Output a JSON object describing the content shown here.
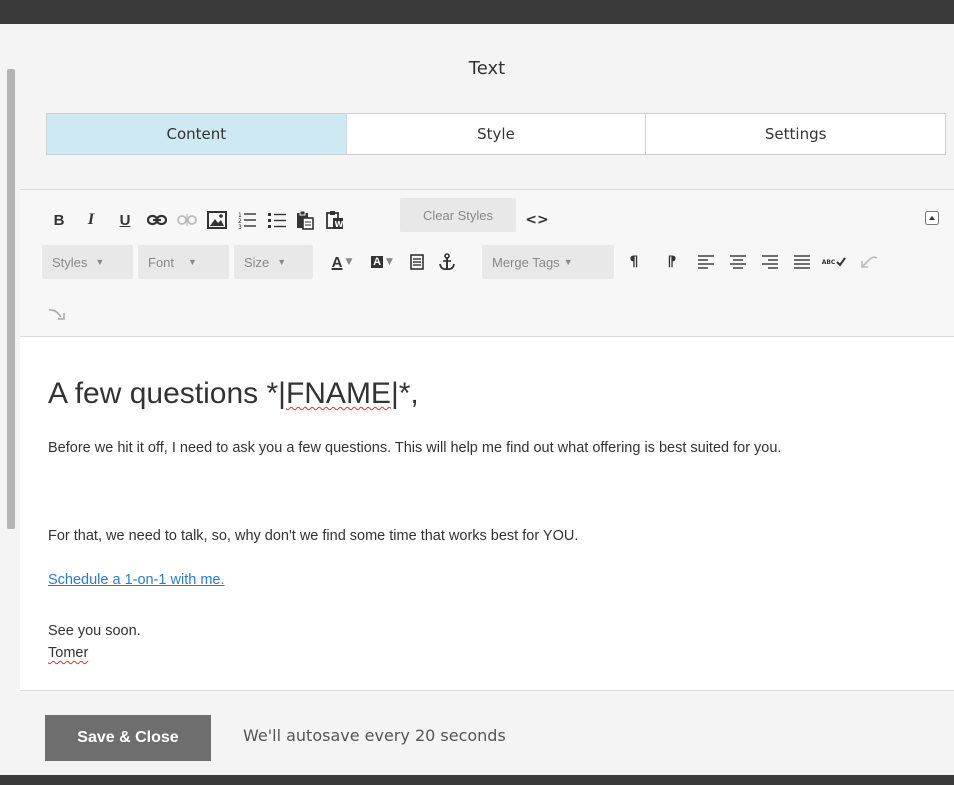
{
  "dialog": {
    "title": "Text"
  },
  "tabs": [
    {
      "label": "Content",
      "active": true
    },
    {
      "label": "Style",
      "active": false
    },
    {
      "label": "Settings",
      "active": false
    }
  ],
  "toolbar": {
    "bold": "B",
    "italic": "I",
    "underline": "U",
    "clear_styles": "Clear Styles",
    "source": "<>",
    "styles": "Styles",
    "font": "Font",
    "size": "Size",
    "text_color": "A",
    "bg_color": "A",
    "merge_tags": "Merge Tags",
    "pilcrow": "¶",
    "rtl": "⁋",
    "spell": "ABC"
  },
  "content": {
    "heading_prefix": "A few questions *|",
    "heading_tag": "FNAME",
    "heading_suffix": "|*,",
    "para1": "Before we hit it off, I need to ask you a few questions. This will help me find out what offering is best suited for you.",
    "para2": "For that, we need to talk, so, why don't we find some time that works best for YOU.",
    "link": "Schedule a 1-on-1 with me.",
    "signoff": "See you soon.",
    "name": "Tomer"
  },
  "footer": {
    "save_label": "Save & Close",
    "autosave_note": "We'll autosave every 20 seconds"
  }
}
